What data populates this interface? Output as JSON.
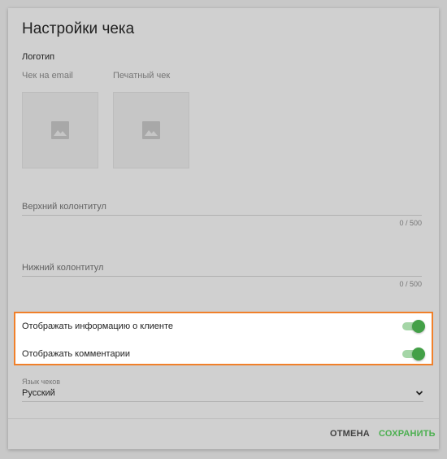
{
  "dialog": {
    "title": "Настройки чека",
    "logo_section": "Логотип",
    "logos": [
      {
        "caption": "Чек на email",
        "icon": "image-icon"
      },
      {
        "caption": "Печатный чек",
        "icon": "image-icon"
      }
    ],
    "header_field": {
      "label": "Верхний колонтитул",
      "counter": "0 / 500",
      "value": ""
    },
    "footer_field": {
      "label": "Нижний колонтитул",
      "counter": "0 / 500",
      "value": ""
    },
    "toggles": [
      {
        "label": "Отображать информацию о клиенте",
        "on": true
      },
      {
        "label": "Отображать комментарии",
        "on": true
      }
    ],
    "language": {
      "label": "Язык чеков",
      "value": "Русский",
      "icon": "chevron-down-icon"
    },
    "buttons": {
      "cancel": "ОТМЕНА",
      "save": "СОХРАНИТЬ"
    }
  },
  "colors": {
    "accent": "#4caf50",
    "highlight_border": "#f0802a"
  }
}
